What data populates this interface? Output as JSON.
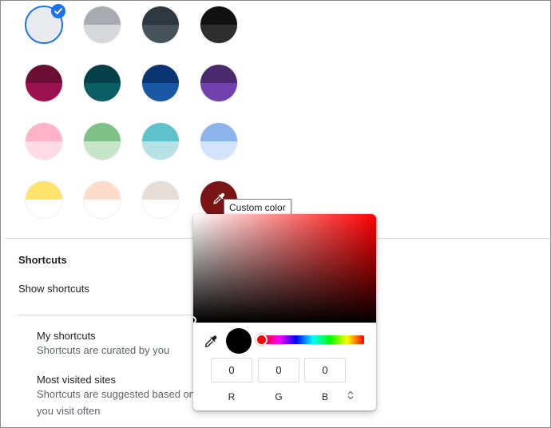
{
  "swatches": {
    "rows": [
      [
        {
          "name": "swatch-default",
          "top": "#e8eaed",
          "bottom": "#e8eaed",
          "selected": true
        },
        {
          "name": "swatch-grey",
          "top": "#a8abb1",
          "bottom": "#d6d8dc",
          "selected": false
        },
        {
          "name": "swatch-charcoal",
          "top": "#2f373f",
          "bottom": "#46535b",
          "selected": false
        },
        {
          "name": "swatch-black",
          "top": "#111111",
          "bottom": "#2e2e2e",
          "selected": false
        }
      ],
      [
        {
          "name": "swatch-burgundy",
          "top": "#6b0e35",
          "bottom": "#9a1350",
          "selected": false
        },
        {
          "name": "swatch-dark-teal",
          "top": "#053f47",
          "bottom": "#0a5e63",
          "selected": false
        },
        {
          "name": "swatch-navy",
          "top": "#0b3572",
          "bottom": "#1b58a3",
          "selected": false
        },
        {
          "name": "swatch-purple",
          "top": "#4a2a6d",
          "bottom": "#7242ac",
          "selected": false
        }
      ],
      [
        {
          "name": "swatch-pink",
          "top": "#ffb3c9",
          "bottom": "#ffdbe5",
          "selected": false
        },
        {
          "name": "swatch-green",
          "top": "#7ec186",
          "bottom": "#c6e5c9",
          "selected": false
        },
        {
          "name": "swatch-aqua",
          "top": "#5fc1c9",
          "bottom": "#b6e2e6",
          "selected": false
        },
        {
          "name": "swatch-blue",
          "top": "#8cb4ec",
          "bottom": "#d3e3fb",
          "selected": false
        }
      ],
      [
        {
          "name": "swatch-yellow",
          "top": "#ffe36b",
          "bottom": "#ffffff",
          "selected": false
        },
        {
          "name": "swatch-peach",
          "top": "#fddccb",
          "bottom": "#ffffff",
          "selected": false
        },
        {
          "name": "swatch-beige",
          "top": "#e5ddd6",
          "bottom": "#ffffff",
          "selected": false
        },
        {
          "name": "swatch-custom",
          "top": "#7a1515",
          "bottom": "#7a1515",
          "selected": false
        }
      ]
    ]
  },
  "tooltip": {
    "text": "Custom color"
  },
  "shortcuts": {
    "title": "Shortcuts",
    "show_label": "Show shortcuts",
    "my_shortcuts": {
      "title": "My shortcuts",
      "desc": "Shortcuts are curated by you"
    },
    "most_visited": {
      "title": "Most visited sites",
      "desc_line1": "Shortcuts are suggested based on",
      "desc_line2": "you visit often"
    }
  },
  "color_picker": {
    "hue_color": "#ff0000",
    "preview_color": "#000000",
    "r_value": "0",
    "g_value": "0",
    "b_value": "0",
    "r_label": "R",
    "g_label": "G",
    "b_label": "B",
    "mode_toggle_icon": "up-down-arrows-icon"
  },
  "colors": {
    "accent": "#1a73e8",
    "divider": "#dadce0"
  }
}
